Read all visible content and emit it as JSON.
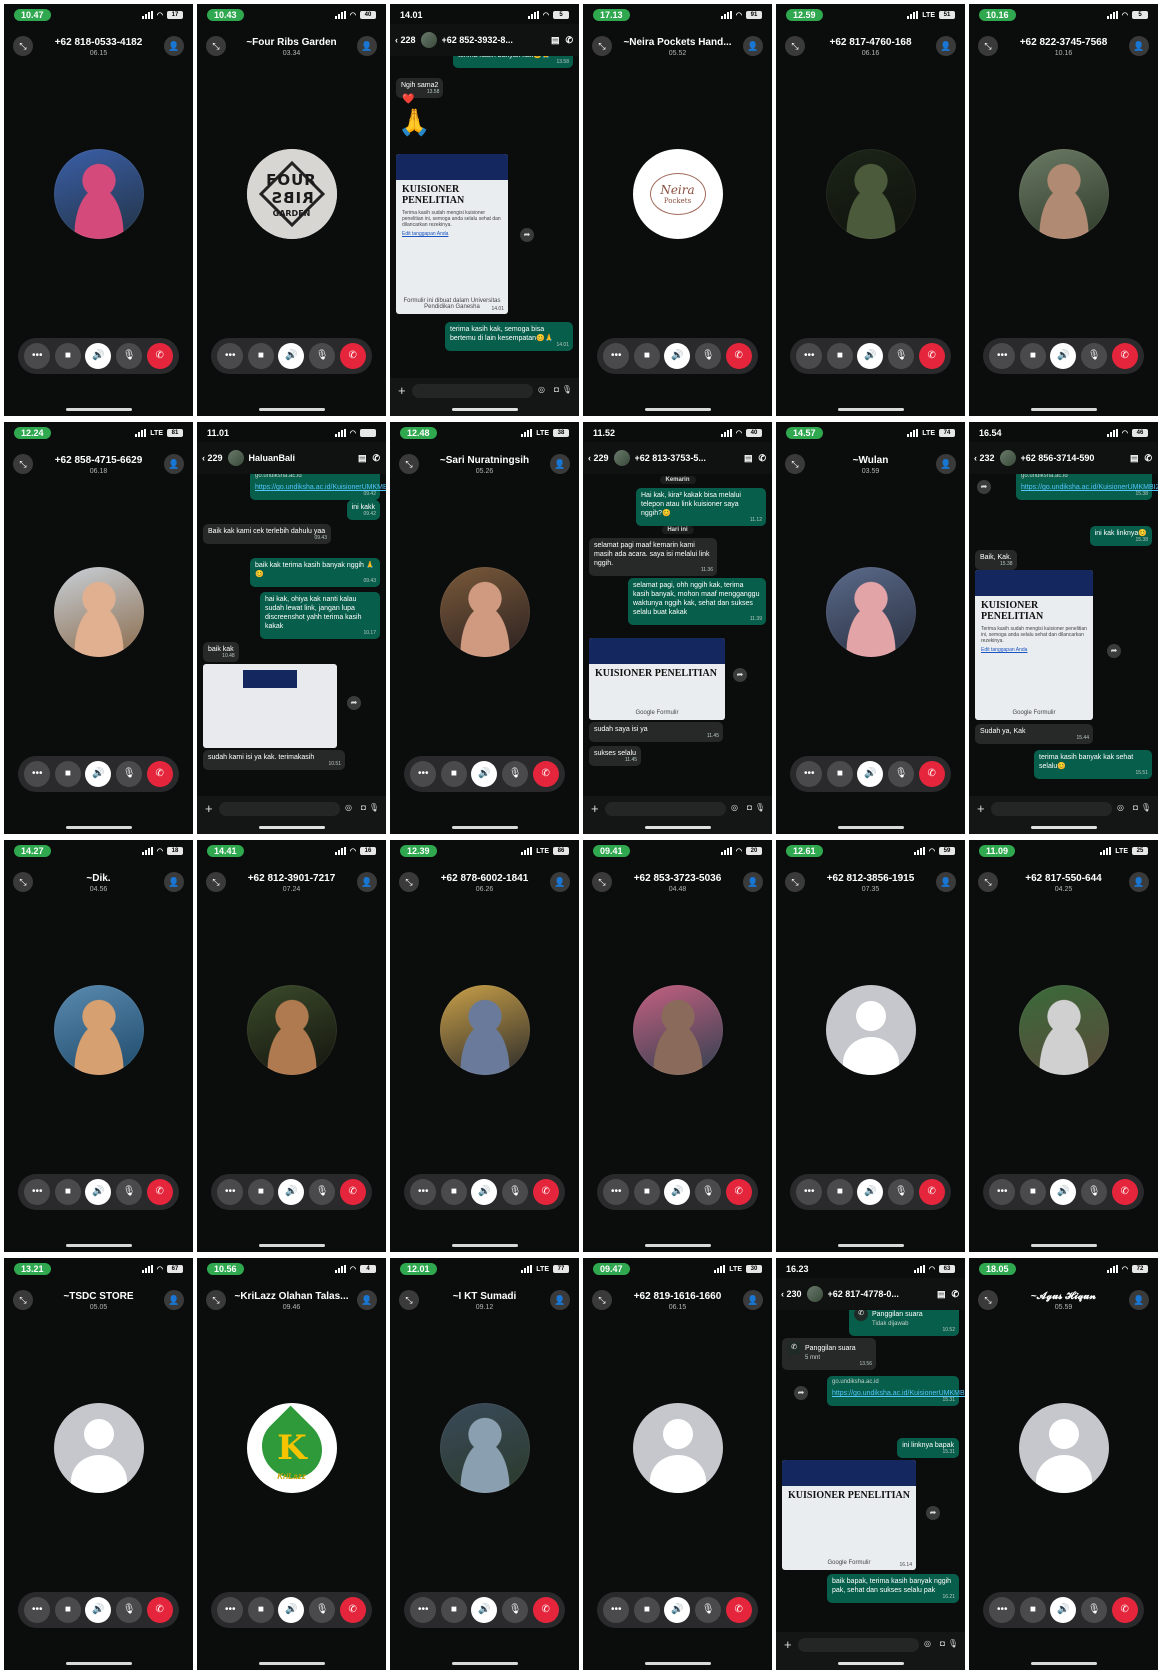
{
  "calls": [
    {
      "time": "10.47",
      "net": "",
      "battery": "17",
      "name": "+62 818-0533-4182",
      "dur": "06.15",
      "avatar": "photo",
      "av_colors": [
        "#3b5fa8",
        "#d44a7a",
        "#223344"
      ]
    },
    {
      "time": "10.43",
      "net": "",
      "battery": "40",
      "name": "~Four Ribs Garden",
      "dur": "03.34",
      "avatar": "fourribs",
      "logo": [
        "FOUR",
        "RIBS",
        "GARDEN"
      ]
    },
    null,
    {
      "time": "17.13",
      "net": "",
      "battery": "91",
      "name": "~Neira Pockets Hand...",
      "dur": "05.52",
      "avatar": "neira",
      "logo": [
        "Neira",
        "Pockets"
      ]
    },
    {
      "time": "12.59",
      "net": "LTE",
      "battery": "51",
      "name": "+62 817-4760-168",
      "dur": "06.16",
      "avatar": "photo",
      "av_colors": [
        "#1c2418",
        "#4a5a3a",
        "#0e120c"
      ]
    },
    {
      "time": "10.16",
      "net": "",
      "battery": "5",
      "name": "+62 822-3745-7568",
      "dur": "10.16",
      "avatar": "photo",
      "av_colors": [
        "#6a7a64",
        "#b08a72",
        "#2f3a2a"
      ]
    },
    {
      "time": "12.24",
      "net": "LTE",
      "battery": "81",
      "name": "+62 858-4715-6629",
      "dur": "06.18",
      "avatar": "photo",
      "av_colors": [
        "#c8d0d8",
        "#e0b090",
        "#8a6a4a"
      ]
    },
    null,
    {
      "time": "12.48",
      "net": "LTE",
      "battery": "38",
      "name": "~Sari Nuratningsih",
      "dur": "05.26",
      "avatar": "photo",
      "av_colors": [
        "#7a5a3a",
        "#d09a80",
        "#2a2020"
      ]
    },
    null,
    {
      "time": "14.57",
      "net": "LTE",
      "battery": "74",
      "name": "~Wulan",
      "dur": "03.59",
      "avatar": "photo",
      "av_colors": [
        "#5a6a8a",
        "#e3a4a8",
        "#2a3040"
      ]
    },
    null,
    {
      "time": "14.27",
      "net": "",
      "battery": "18",
      "name": "~Dik.",
      "dur": "04.56",
      "avatar": "photo",
      "av_colors": [
        "#5a8ab0",
        "#d6a070",
        "#1e4a6a"
      ]
    },
    {
      "time": "14.41",
      "net": "",
      "battery": "16",
      "name": "+62 812-3901-7217",
      "dur": "07.24",
      "avatar": "photo",
      "av_colors": [
        "#3a4a2a",
        "#b07a50",
        "#14140e"
      ]
    },
    {
      "time": "12.39",
      "net": "LTE",
      "battery": "86",
      "name": "+62 878-6002-1841",
      "dur": "06.26",
      "avatar": "photo",
      "av_colors": [
        "#c9a048",
        "#6a7a9a",
        "#2a2a2a"
      ]
    },
    {
      "time": "09.41",
      "net": "",
      "battery": "20",
      "name": "+62 853-3723-5036",
      "dur": "04.48",
      "avatar": "photo",
      "av_colors": [
        "#c46080",
        "#8a6a5a",
        "#304050"
      ]
    },
    {
      "time": "12.61",
      "net": "",
      "battery": "59",
      "name": "+62 812-3856-1915",
      "dur": "07.35",
      "avatar": "placeholder"
    },
    {
      "time": "11.09",
      "net": "LTE",
      "battery": "25",
      "name": "+62 817-550-644",
      "dur": "04.25",
      "avatar": "photo",
      "av_colors": [
        "#3a6a3a",
        "#d0d0d0",
        "#5a4a3a"
      ]
    },
    {
      "time": "13.21",
      "net": "",
      "battery": "67",
      "name": "~TSDC STORE",
      "dur": "05.05",
      "avatar": "placeholder"
    },
    {
      "time": "10.56",
      "net": "",
      "battery": "4",
      "name": "~KriLazz Olahan Talas...",
      "dur": "09.46",
      "avatar": "krilazz",
      "logo": [
        "K",
        "KriLazz"
      ]
    },
    {
      "time": "12.01",
      "net": "LTE",
      "battery": "77",
      "name": "~I KT Sumadi",
      "dur": "09.12",
      "avatar": "photo",
      "av_colors": [
        "#3a4a5a",
        "#8aa0b0",
        "#2a3a2a"
      ]
    },
    {
      "time": "09.47",
      "net": "LTE",
      "battery": "30",
      "name": "+62 819-1616-1660",
      "dur": "06.15",
      "avatar": "placeholder"
    },
    null,
    {
      "time": "18.05",
      "net": "",
      "battery": "72",
      "name": "~𝓐𝓰𝓾𝓼 𝓗𝓲𝓺𝓾𝓷",
      "dur": "05.59",
      "avatar": "placeholder"
    }
  ],
  "chats": {
    "c3": {
      "time": "14.01",
      "battery": "5",
      "count": "228",
      "title": "+62 852-3932-8...",
      "msgs": [
        {
          "text": "terima kasih banyak kak😊🙏",
          "t": "13.58"
        },
        {
          "text": "Ngih sama2",
          "t": "13.58"
        },
        {
          "text": "❤️"
        },
        {
          "text": "🙏",
          "t": "13.58"
        },
        {
          "text": "terima kasih kak, semoga bisa bertemu di lain kesempatan😊🙏",
          "t": "14.01"
        }
      ],
      "card": {
        "title": "KUISIONER PENELITIAN",
        "body": "Terima kasih sudah mengisi kuisioner penelitian ini, semoga anda selalu sehat dan dilancarkan rezekinya.",
        "link": "Edit tanggapan Anda",
        "foot": "Formulir ini dibuat dalam Universitas Pendidikan Ganesha",
        "t": "14.01"
      }
    },
    "c8": {
      "time": "11.01",
      "battery": "",
      "count": "229",
      "title": "HaluanBali",
      "msgs": [
        {
          "sub": "go.undiksha.ac.id",
          "link": "https://go.undiksha.ac.id/KuisionerUMKMBI2024",
          "t": "09.42"
        },
        {
          "text": "ini kakk",
          "t": "09.42"
        },
        {
          "text": "Baik kak kami cek terlebih dahulu yaa",
          "t": "09.43"
        },
        {
          "text": "baik kak terima kasih banyak nggih 🙏😊",
          "t": "09.43"
        },
        {
          "text": "hai kak, ohiya kak nanti kalau sudah lewat link, jangan lupa discreenshot yahh terima kasih kakak",
          "t": "10.17"
        },
        {
          "text": "baik kak",
          "t": "10.48"
        },
        {
          "text": "sudah kami isi ya kak. terimakasih",
          "t": "10.51"
        }
      ]
    },
    "c10": {
      "time": "11.52",
      "battery": "40",
      "count": "229",
      "title": "+62 813-3753-5...",
      "msgs": [
        {
          "text": "Kemarin"
        },
        {
          "text": "Hai kak, kira² kakak bisa melalui telepon atau link kuisioner saya nggih?😊",
          "t": "11.12"
        },
        {
          "text": "Hari ini"
        },
        {
          "text": "selamat pagi maaf kemarin kami masih ada acara. saya isi melalui link nggih.",
          "t": "11.36"
        },
        {
          "text": "selamat pagi, ohh nggih kak, terima kasih banyak, mohon maaf mengganggu waktunya nggih kak, sehat dan sukses selalu buat kakak",
          "t": "11.39"
        },
        {
          "text": "sudah saya isi ya",
          "t": "11.45"
        },
        {
          "text": "sukses selalu",
          "t": "11.45"
        }
      ],
      "card": {
        "title": "KUISIONER PENELITIAN",
        "foot": "Google Formulir"
      }
    },
    "c12": {
      "time": "16.54",
      "battery": "46",
      "count": "232",
      "title": "+62 856-3714-590",
      "msgs": [
        {
          "sub": "go.undiksha.ac.id",
          "link": "https://go.undiksha.ac.id/KuisionerUMKMBI2024",
          "t": "15.38"
        },
        {
          "text": "ini kak linknya😊",
          "t": "15.38"
        },
        {
          "text": "Baik, Kak.",
          "t": "15.38"
        },
        {
          "text": "Sudah ya, Kak",
          "t": "15.44"
        },
        {
          "text": "terima kasih banyak kak sehat selalu😊",
          "t": "15.51"
        }
      ],
      "card": {
        "title": "KUISIONER PENELITIAN",
        "body": "Terima kasih sudah mengisi kuisioner penelitian ini, semoga anda selalu sehat dan dilancarkan rezekinya.",
        "link": "Edit tanggapan Anda",
        "foot": "Google Formulir"
      }
    },
    "c23": {
      "time": "16.23",
      "battery": "63",
      "count": "230",
      "title": "+62 817-4778-0...",
      "msgs": [
        {
          "text": "Panggilan suara",
          "sub": "Tidak dijawab",
          "t": "10.52"
        },
        {
          "text": "Panggilan suara",
          "sub": "5 mnt",
          "t": "13.56"
        },
        {
          "sub": "go.undiksha.ac.id",
          "link": "https://go.undiksha.ac.id/KuisionerUMKMBI2024",
          "t": "15.31"
        },
        {
          "text": "ini linknya bapak",
          "t": "15.31"
        },
        {
          "text": "baik bapak, terima kasih banyak nggih pak, sehat dan sukses selalu pak",
          "t": "16.21"
        }
      ],
      "card": {
        "title": "KUISIONER PENELITIAN",
        "foot": "Google Formulir",
        "t": "16.14"
      }
    }
  }
}
